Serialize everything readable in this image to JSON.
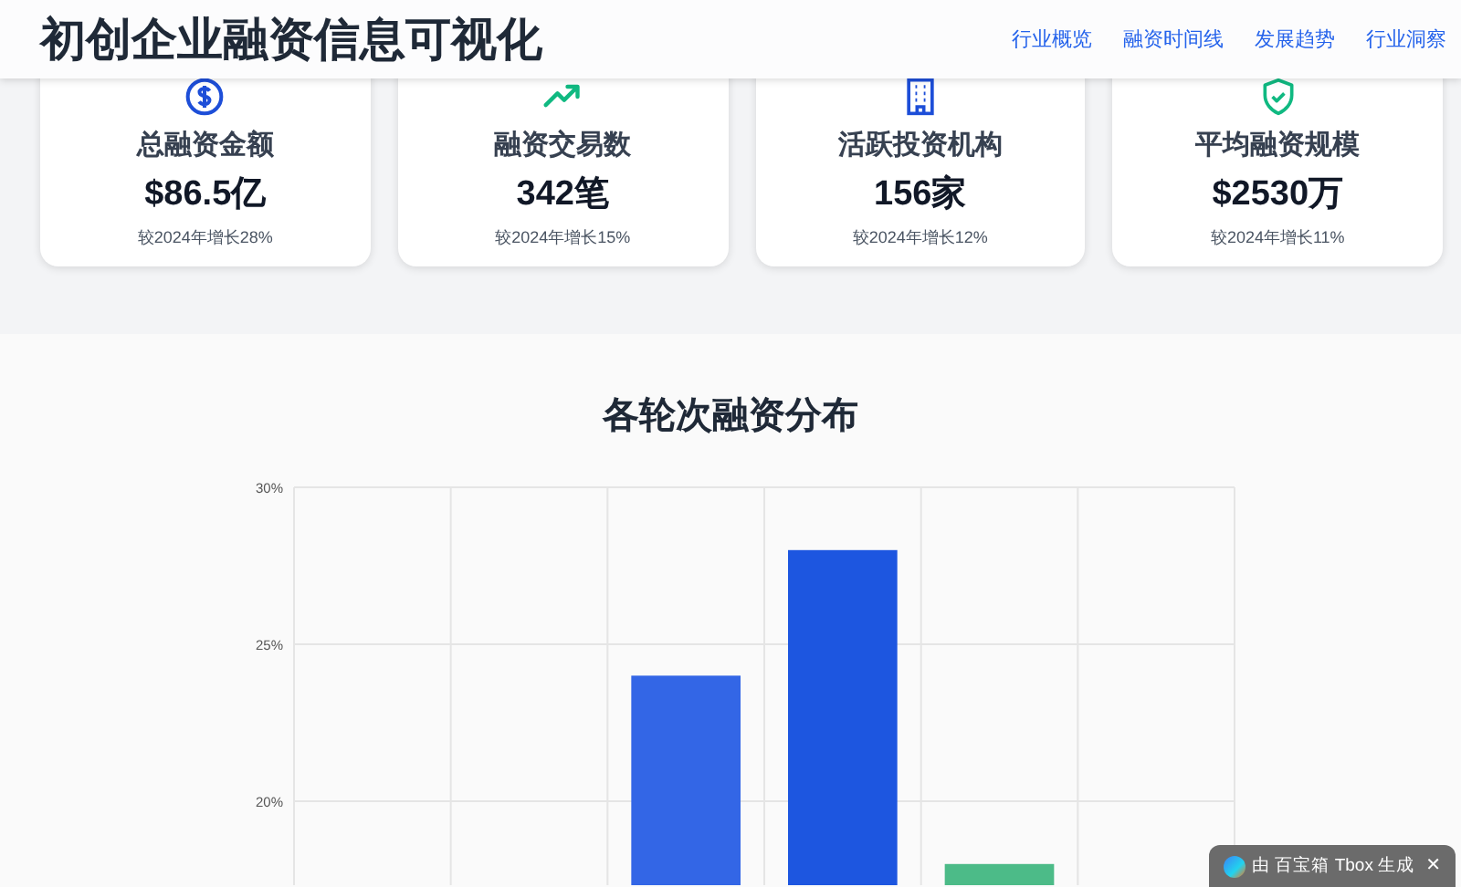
{
  "header": {
    "title": "初创企业融资信息可视化",
    "nav": [
      {
        "label": "行业概览"
      },
      {
        "label": "融资时间线"
      },
      {
        "label": "发展趋势"
      },
      {
        "label": "行业洞察"
      }
    ]
  },
  "stats": [
    {
      "kind": "dollar",
      "color": "#1d4ed8",
      "label": "总融资金额",
      "value": "$86.5亿",
      "change": "较2024年增长28%"
    },
    {
      "kind": "trend",
      "color": "#10b981",
      "label": "融资交易数",
      "value": "342笔",
      "change": "较2024年增长15%"
    },
    {
      "kind": "building",
      "color": "#1d4ed8",
      "label": "活跃投资机构",
      "value": "156家",
      "change": "较2024年增长12%"
    },
    {
      "kind": "shield",
      "color": "#10b981",
      "label": "平均融资规模",
      "value": "$2530万",
      "change": "较2024年增长11%"
    }
  ],
  "chart_section": {
    "title": "各轮次融资分布",
    "chart_data": {
      "type": "bar",
      "values": [
        null,
        null,
        24,
        28,
        18,
        null
      ],
      "ylim": [
        17.3,
        30
      ],
      "yticks": [
        {
          "value": 20,
          "label": "20%"
        },
        {
          "value": 25,
          "label": "25%"
        },
        {
          "value": 30,
          "label": "30%"
        }
      ]
    }
  },
  "badge": {
    "text": "由 百宝箱 Tbox 生成",
    "close": "✕"
  }
}
